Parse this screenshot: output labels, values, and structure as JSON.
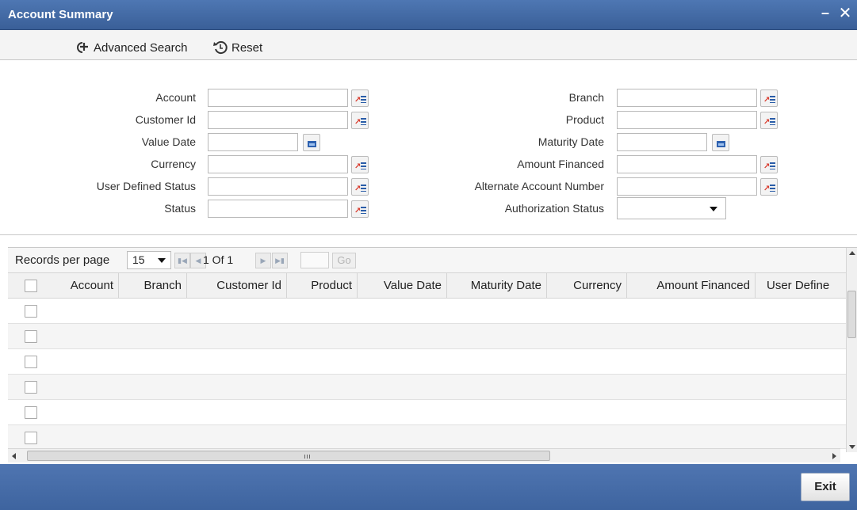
{
  "window": {
    "title": "Account Summary",
    "minimize_glyph": "‗",
    "close_glyph": "✕"
  },
  "toolbar": {
    "advanced_search_label": "Advanced Search",
    "reset_label": "Reset"
  },
  "form": {
    "account_label": "Account",
    "customer_id_label": "Customer Id",
    "value_date_label": "Value Date",
    "currency_label": "Currency",
    "user_defined_status_label": "User Defined Status",
    "status_label": "Status",
    "branch_label": "Branch",
    "product_label": "Product",
    "maturity_date_label": "Maturity Date",
    "amount_financed_label": "Amount Financed",
    "alternate_account_number_label": "Alternate Account Number",
    "authorization_status_label": "Authorization Status",
    "account_value": "",
    "customer_id_value": "",
    "value_date_value": "",
    "currency_value": "",
    "user_defined_status_value": "",
    "status_value": "",
    "branch_value": "",
    "product_value": "",
    "maturity_date_value": "",
    "amount_financed_value": "",
    "alternate_account_number_value": "",
    "authorization_status_value": ""
  },
  "pager": {
    "records_per_page_label": "Records per page",
    "records_per_page_value": "15",
    "page_info": "1 Of 1",
    "go_label": "Go"
  },
  "table": {
    "columns": [
      "Account",
      "Branch",
      "Customer Id",
      "Product",
      "Value Date",
      "Maturity Date",
      "Currency",
      "Amount Financed",
      "User Define"
    ],
    "rows": [
      [],
      [],
      [],
      [],
      [],
      []
    ]
  },
  "footer": {
    "exit_label": "Exit"
  },
  "icons": {
    "lov": "list-of-values-icon",
    "calendar": "calendar-icon",
    "advanced_search": "advanced-search-icon",
    "reset": "reset-icon"
  },
  "colors": {
    "titlebar": "#4467a3",
    "footer": "#4769a8",
    "lov_arrow": "#d8382a",
    "lov_lines": "#2a5da8"
  }
}
